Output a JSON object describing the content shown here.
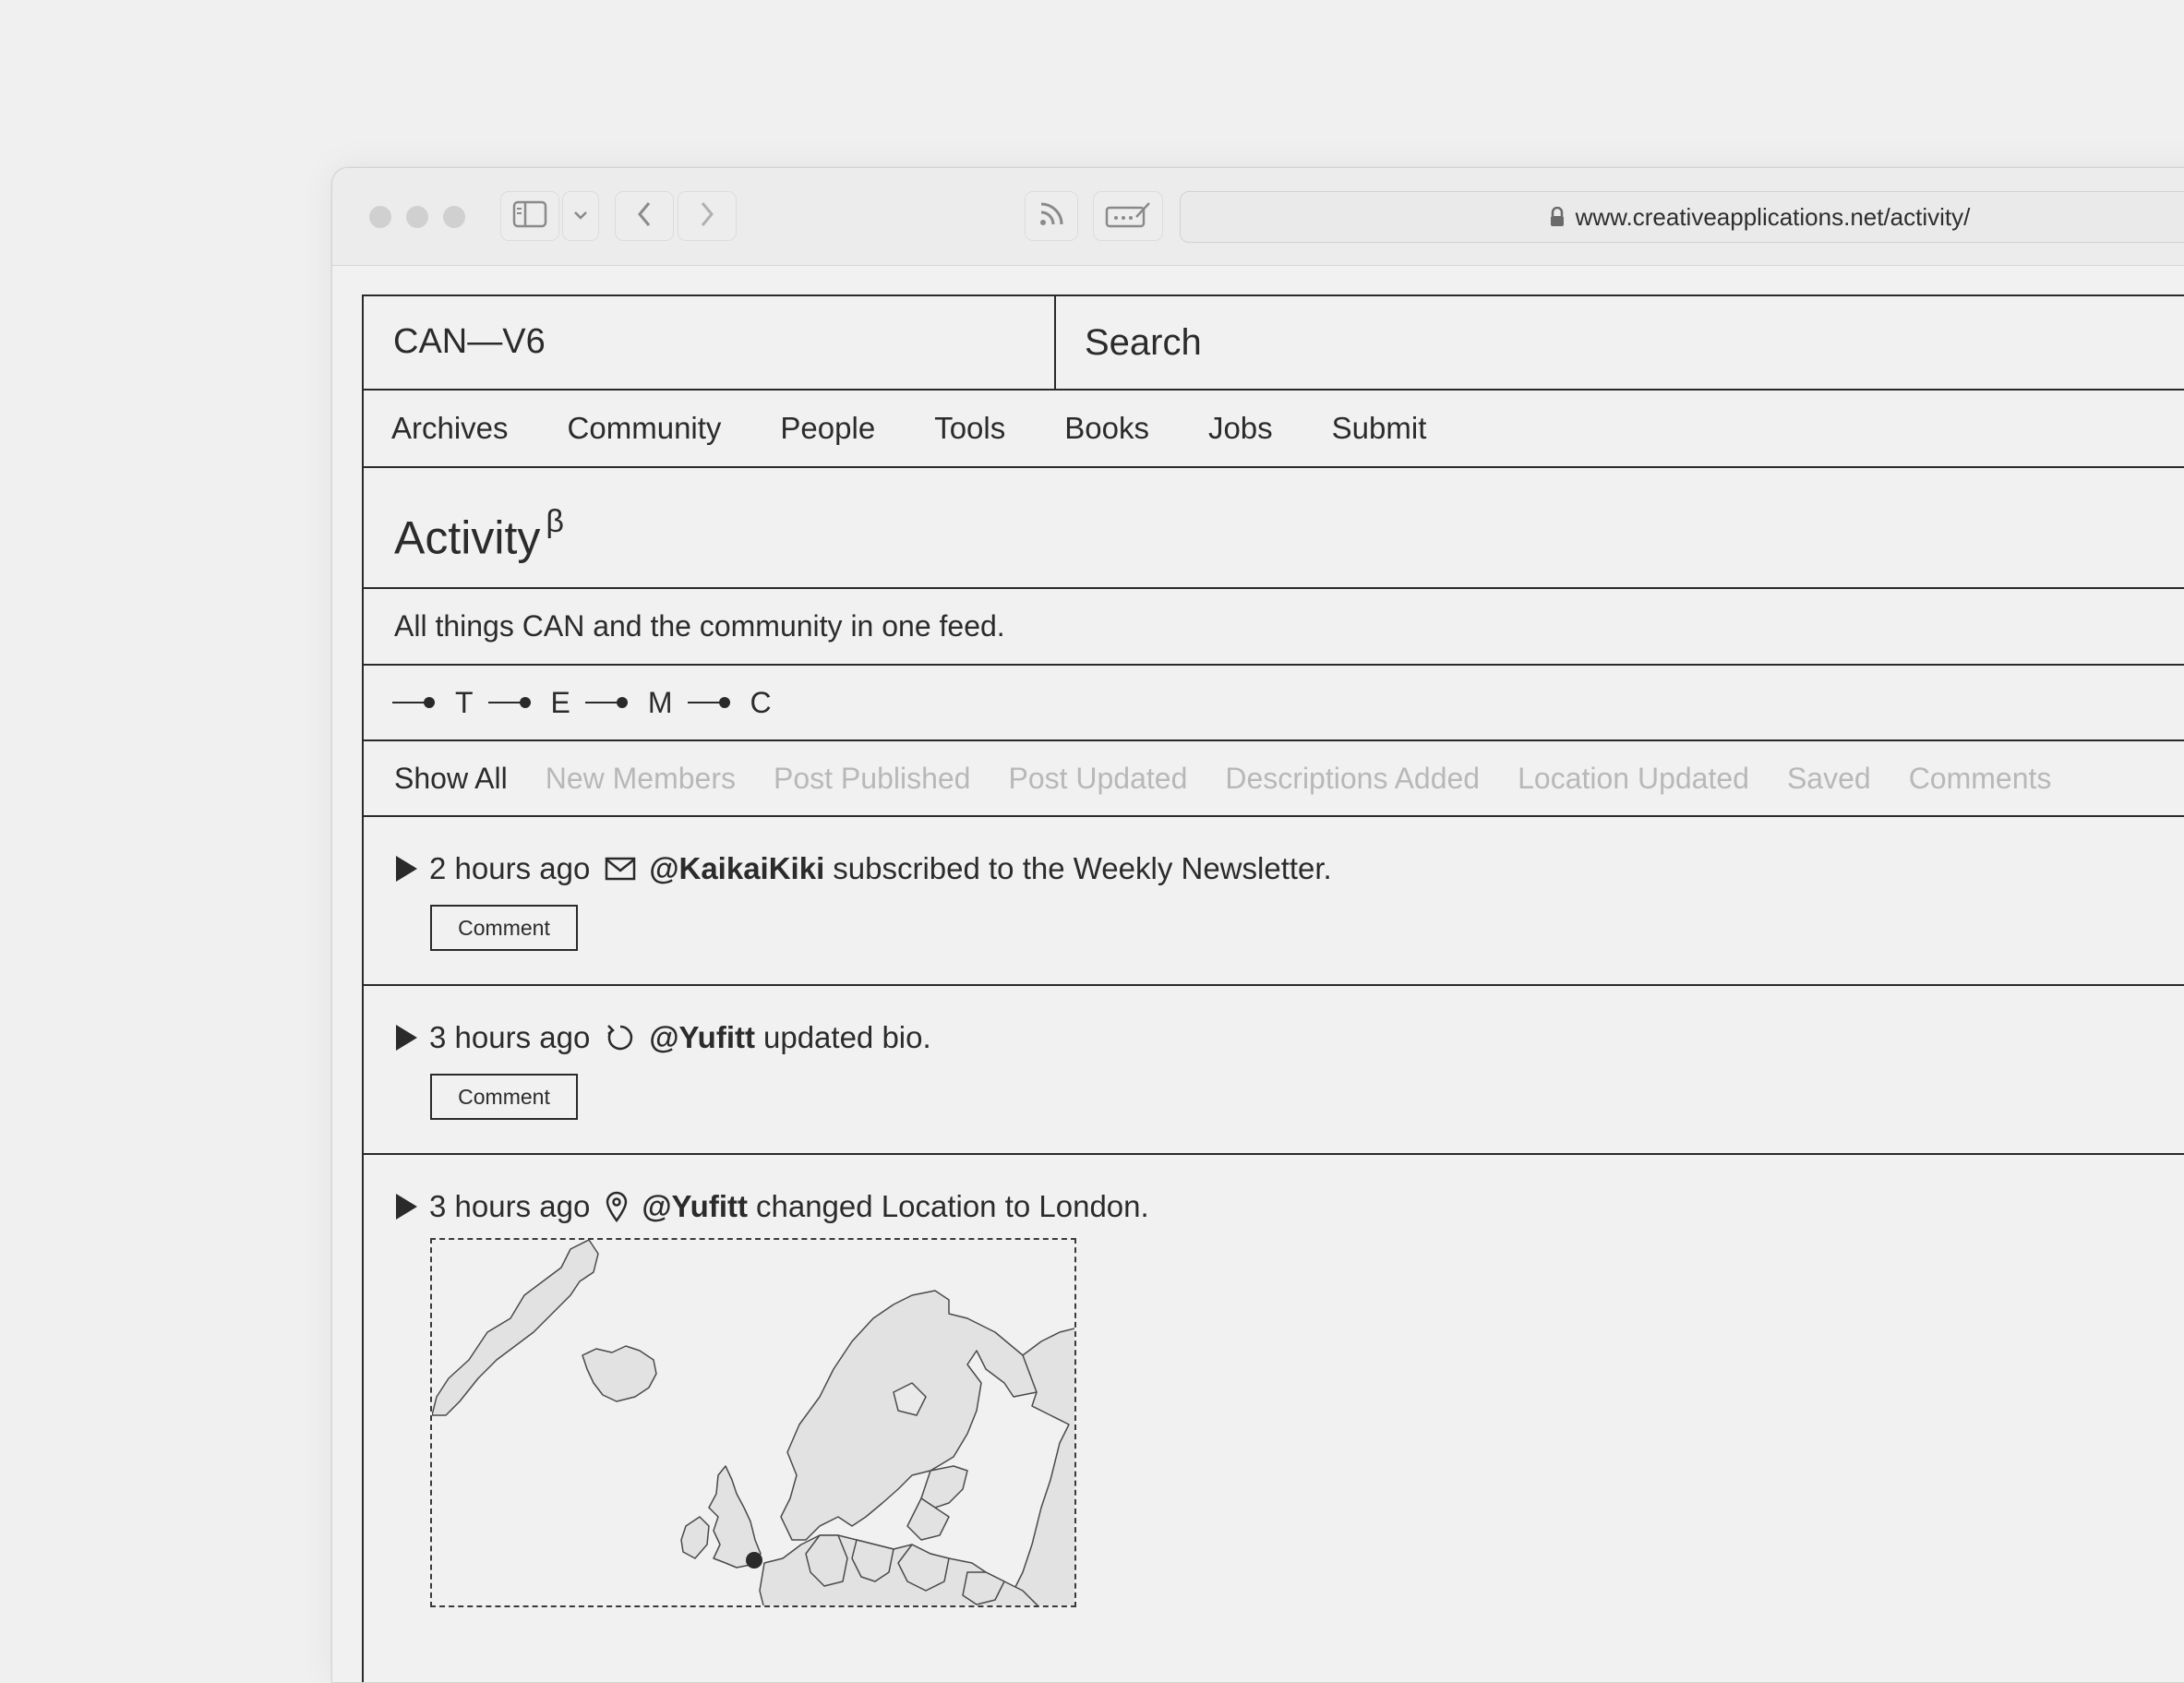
{
  "browser": {
    "url": "www.creativeapplications.net/activity/"
  },
  "header": {
    "logo": "CAN—V6",
    "search_label": "Search"
  },
  "nav": [
    "Archives",
    "Community",
    "People",
    "Tools",
    "Books",
    "Jobs",
    "Submit"
  ],
  "page": {
    "title": "Activity",
    "title_sup": "β",
    "tagline": "All things CAN and the community in one feed."
  },
  "legend": [
    "T",
    "E",
    "M",
    "C"
  ],
  "filters": {
    "active": "Show All",
    "others": [
      "New Members",
      "Post Published",
      "Post Updated",
      "Descriptions Added",
      "Location Updated",
      "Saved",
      "Comments"
    ]
  },
  "feed": [
    {
      "time": "2 hours ago",
      "icon": "envelope-icon",
      "user": "@KaikaiKiki",
      "text": "subscribed to the Weekly Newsletter.",
      "button": "Comment"
    },
    {
      "time": "3 hours ago",
      "icon": "refresh-icon",
      "user": "@Yufitt",
      "text": "updated bio.",
      "button": "Comment"
    },
    {
      "time": "3 hours ago",
      "icon": "location-pin-icon",
      "user": "@Yufitt",
      "text": "changed Location to London."
    }
  ],
  "colors": {
    "text": "#2b2b2b",
    "muted": "#b8b8b8",
    "background": "#f1f1f1",
    "land": "#e2e2e2"
  }
}
